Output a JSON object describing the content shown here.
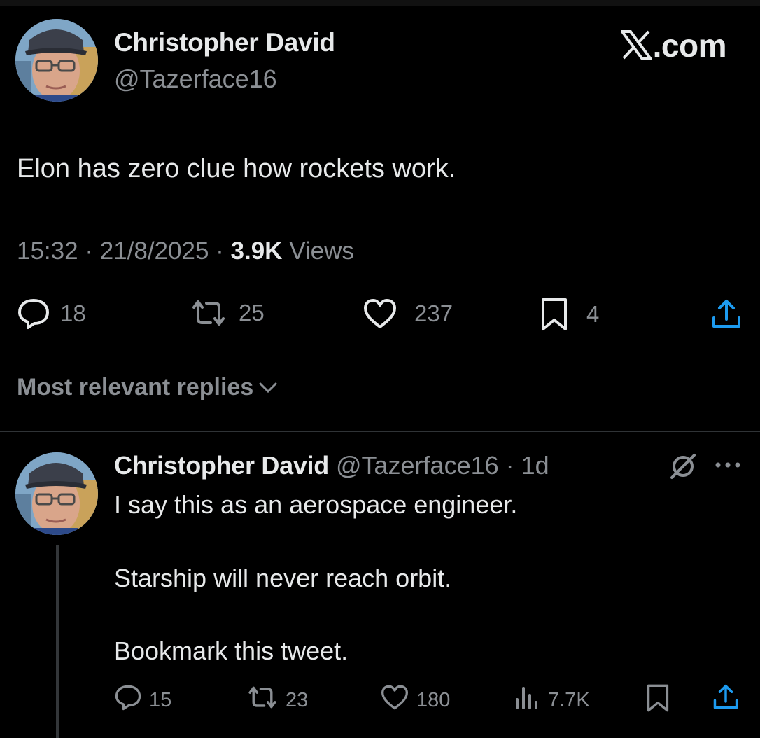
{
  "brand": {
    "label": ".com"
  },
  "tweet": {
    "author_name": "Christopher David",
    "author_handle": "@Tazerface16",
    "text": "Elon has zero clue how rockets work.",
    "time": "15:32",
    "sep1": " · ",
    "date": "21/8/2025",
    "sep2": " · ",
    "views_count": "3.9K",
    "views_label": " Views",
    "actions": {
      "replies": "18",
      "reposts": "25",
      "likes": "237",
      "bookmarks": "4"
    }
  },
  "replies_section": {
    "label": "Most relevant replies"
  },
  "reply": {
    "author_name": "Christopher David",
    "author_handle": "@Tazerface16",
    "dot": " · ",
    "time": "1d",
    "line1": "I say this as an aerospace engineer.",
    "line2": "Starship will never reach orbit.",
    "line3": "Bookmark this tweet.",
    "actions": {
      "replies": "15",
      "reposts": "23",
      "likes": "180",
      "views": "7.7K"
    }
  },
  "icons": [
    "x-logo-icon",
    "reply-icon",
    "repost-icon",
    "like-icon",
    "bookmark-icon",
    "share-icon",
    "chevron-down-icon",
    "grok-icon",
    "more-icon",
    "views-icon"
  ],
  "colors": {
    "background": "#000000",
    "primary_text": "#e7e9ea",
    "secondary_text": "#8b8f94",
    "divider": "#2f3336"
  }
}
